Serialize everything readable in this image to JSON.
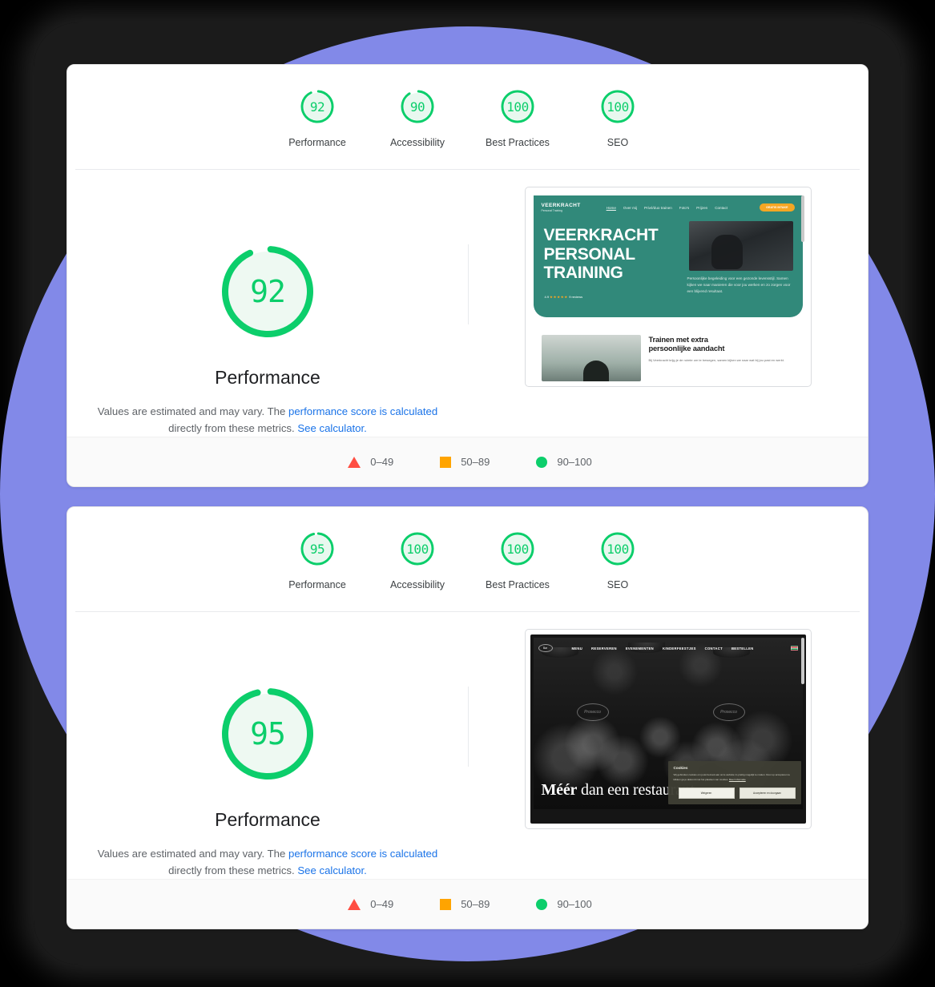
{
  "theme": {
    "page_background": "#000000",
    "backdrop": "#1b1b1b",
    "accent_purple": "#8289e8",
    "score_green": "#0cce6b",
    "score_orange": "#ffa400",
    "score_red": "#ff4e42",
    "link_blue": "#1a73e8"
  },
  "reports": [
    {
      "summary": [
        {
          "label": "Performance",
          "score": 92,
          "icon": "gauge-icon"
        },
        {
          "label": "Accessibility",
          "score": 90,
          "icon": "gauge-icon"
        },
        {
          "label": "Best Practices",
          "score": 100,
          "icon": "gauge-icon"
        },
        {
          "label": "SEO",
          "score": 100,
          "icon": "gauge-icon"
        }
      ],
      "detail": {
        "score": 92,
        "title": "Performance",
        "description_prefix": "Values are estimated and may vary. The ",
        "description_link_1": "performance score is calculated",
        "description_middle": " directly from these metrics. ",
        "description_link_2": "See calculator."
      },
      "legend": [
        {
          "icon": "triangle-icon",
          "label": "0–49"
        },
        {
          "icon": "square-icon",
          "label": "50–89"
        },
        {
          "icon": "circle-icon",
          "label": "90–100"
        }
      ],
      "thumbnail": {
        "site": "veerkracht-personal-training",
        "logo_primary": "VEERKRACHT",
        "logo_secondary": "Personal Training",
        "nav": [
          "Home",
          "Over mij",
          "Privé/duo trainen",
          "Foto's",
          "Prijzen",
          "Contact"
        ],
        "cta": "GRATIS INTAKE",
        "hero_heading": "VEERKRACHT PERSONAL TRAINING",
        "hero_rating": "4.9 ★★★★★ 9 reviews",
        "hero_paragraph": "Persoonlijke begeleiding voor een gezonde levensstijl. Samen kijken we naar manieren die voor jou werken en zo zorgen voor een blijvend resultaat.",
        "section_heading": "Trainen met extra persoonlijke aandacht",
        "section_paragraph": "Bij Veerkracht krijg je de ruimte om te bewegen, samen kijken we naar wat bij jou past en werkt."
      }
    },
    {
      "summary": [
        {
          "label": "Performance",
          "score": 95,
          "icon": "gauge-icon"
        },
        {
          "label": "Accessibility",
          "score": 100,
          "icon": "gauge-icon"
        },
        {
          "label": "Best Practices",
          "score": 100,
          "icon": "gauge-icon"
        },
        {
          "label": "SEO",
          "score": 100,
          "icon": "gauge-icon"
        }
      ],
      "detail": {
        "score": 95,
        "title": "Performance",
        "description_prefix": "Values are estimated and may vary. The ",
        "description_link_1": "performance score is calculated",
        "description_middle": " directly from these metrics. ",
        "description_link_2": "See calculator."
      },
      "legend": [
        {
          "icon": "triangle-icon",
          "label": "0–49"
        },
        {
          "icon": "square-icon",
          "label": "50–89"
        },
        {
          "icon": "circle-icon",
          "label": "90–100"
        }
      ],
      "thumbnail": {
        "site": "restaurant",
        "logo_primary": "Bar",
        "nav": [
          "MENU",
          "RESERVEREN",
          "EVENEMENTEN",
          "KINDERFEESTJES",
          "CONTACT",
          "BESTELLEN"
        ],
        "neon_left": "Prosecco",
        "neon_right": "Prosecco",
        "hero_heading_bold": "Méér",
        "hero_heading_rest": " dan een restaurant",
        "cookie_title": "Cookies",
        "cookie_text": "Wij gebruiken cookies om jouw bezoek aan onze website zo prettig mogelijk te maken. Door op accepteren te klikken ga je akkoord met het plaatsen van cookies.",
        "cookie_link": "Meer informatie",
        "cookie_btn_decline": "Weigeren",
        "cookie_btn_accept": "Accepteren en doorgaan"
      }
    }
  ]
}
